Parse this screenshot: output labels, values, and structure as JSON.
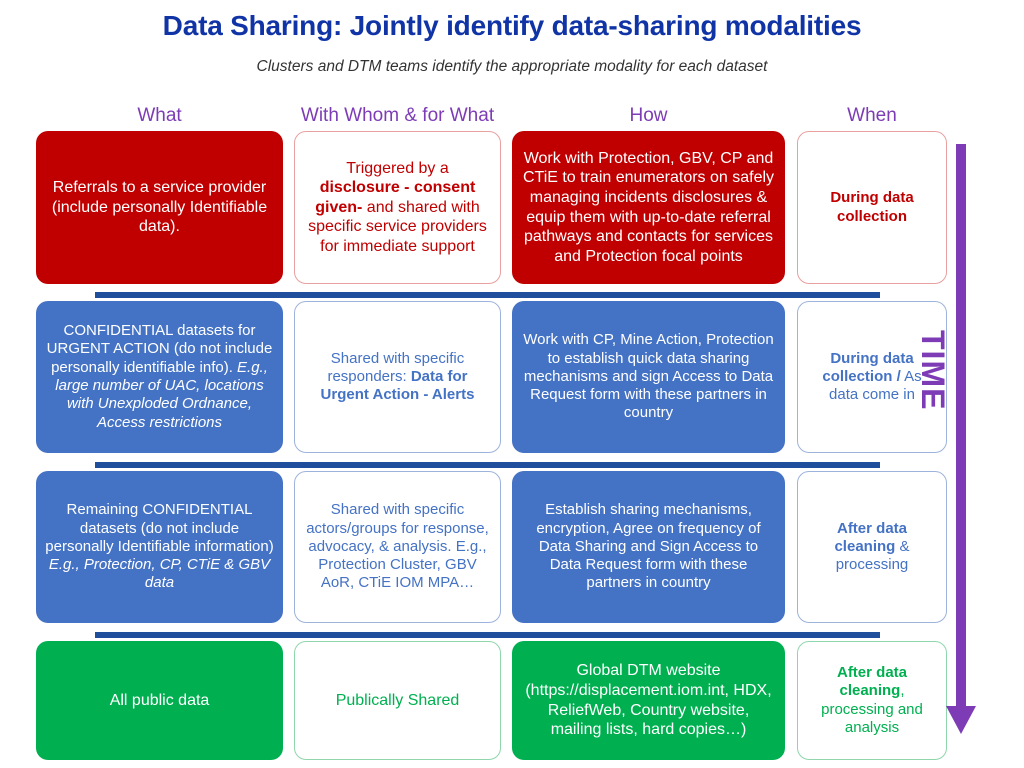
{
  "slide": {
    "title": "Data Sharing: Jointly identify data-sharing modalities",
    "subtitle": "Clusters and DTM teams identify the appropriate modality for each dataset"
  },
  "colors": {
    "title_blue": "#1034A6",
    "header_purple": "#7D3CB5",
    "red": "#C00000",
    "blue": "#4472C4",
    "green": "#00B050",
    "divider_blue": "#1F4E9C"
  },
  "headers": [
    {
      "label": "What"
    },
    {
      "label": "With Whom & for What"
    },
    {
      "label": "How"
    },
    {
      "label": "When"
    }
  ],
  "timeline": {
    "label": "TIME",
    "direction": "down",
    "color": "#7D3CB5"
  },
  "rows": [
    {
      "id": "row-referrals",
      "color": "red",
      "what": "Referrals to a service provider (include personally Identifiable data).",
      "with_whom_html": "Triggered by a <b>disclosure - consent given-</b> and shared with specific service providers for immediate support",
      "how": "Work with Protection, GBV, CP and CTiE to train enumerators on safely managing incidents disclosures &amp; equip them with up-to-date referral pathways and contacts for services and Protection focal points",
      "when_html": "<b>During data collection</b>"
    },
    {
      "id": "row-confidential-urgent",
      "color": "blue",
      "what_html": "CONFIDENTIAL datasets for URGENT ACTION (do not include personally identifiable info). <i>E.g., large number of UAC, locations with Unexploded Ordnance, Access restrictions</i>",
      "with_whom_html": "Shared with specific responders: <b>Data for Urgent Action - Alerts</b>",
      "how": "Work with CP, Mine Action, Protection to establish quick data sharing mechanisms and sign Access to Data Request form with these partners in country",
      "when_html": "<b>During data collection /</b> As data come in"
    },
    {
      "id": "row-confidential-remaining",
      "color": "blue",
      "what_html": "Remaining CONFIDENTIAL datasets (do not include personally Identifiable information) <i>E.g., Protection, CP, CTiE &amp; GBV data</i>",
      "with_whom": "Shared with specific actors/groups for response, advocacy, & analysis. E.g., Protection Cluster, GBV AoR, CTiE IOM MPA…",
      "how": "Establish sharing mechanisms, encryption, Agree on frequency of Data Sharing and Sign Access to Data Request form with these partners in country",
      "when_html": "<b>After data cleaning</b> &amp; processing"
    },
    {
      "id": "row-public",
      "color": "green",
      "what": "All public data",
      "with_whom": "Publically Shared",
      "how": "Global DTM website (https://displacement.iom.int, HDX, ReliefWeb, Country website, mailing lists,  hard copies…)",
      "when_html": "<b>After data cleaning</b>, processing and analysis"
    }
  ]
}
